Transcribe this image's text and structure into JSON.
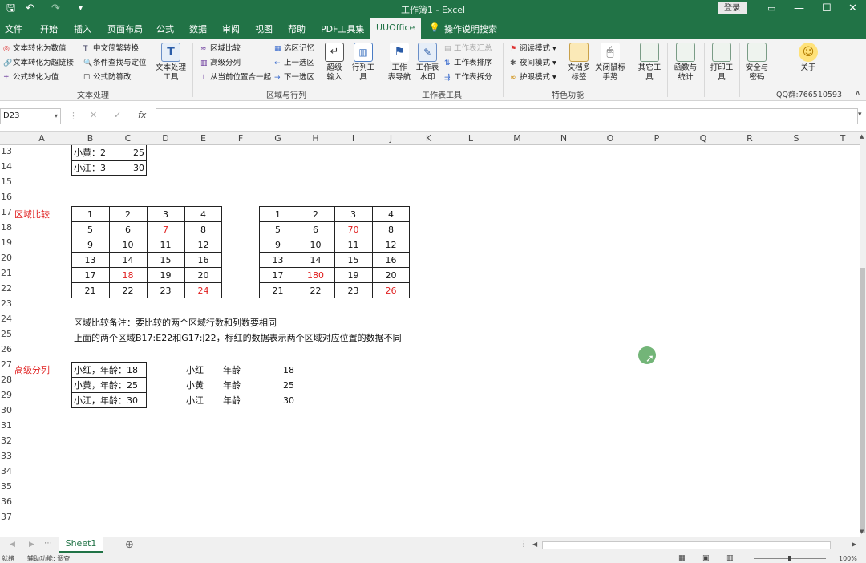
{
  "titlebar": {
    "title": "工作簿1 - Excel",
    "login_label": "登录",
    "save_icon": "save-icon",
    "undo_icon": "undo-icon",
    "redo_icon": "redo-icon"
  },
  "tabs": [
    "文件",
    "开始",
    "插入",
    "页面布局",
    "公式",
    "数据",
    "审阅",
    "视图",
    "帮助",
    "PDF工具集",
    "UUOffice",
    "操作说明搜索"
  ],
  "active_tab": "UUOffice",
  "ribbon": {
    "text_group": {
      "items": [
        "文本转化为数值",
        "中文简繁转换",
        "文本转化为超链接",
        "条件查找与定位",
        "公式转化为值",
        "公式防篡改"
      ],
      "big_button": "文本处理\n工具",
      "label": "文本处理"
    },
    "region_group": {
      "items": [
        "区域比较",
        "高级分列",
        "从当前位置合一起",
        "选区记忆",
        "上一选区",
        "下一选区"
      ],
      "big1": "超级\n输入",
      "big2": "行列工\n具",
      "label": "区域与行列"
    },
    "sheet_group": {
      "big1": "工作\n表导航",
      "big2": "工作表\n水印",
      "items": [
        "工作表汇总",
        "工作表排序",
        "工作表拆分"
      ],
      "label": "工作表工具"
    },
    "special_group": {
      "items": [
        "阅读模式",
        "夜间模式",
        "护眼模式"
      ],
      "big1": "文档多\n标签",
      "big2": "关闭鼠标\n手势",
      "label": "特色功能"
    },
    "misc_buttons": [
      "其它工\n具",
      "函数与\n统计",
      "打印工\n具",
      "安全与\n密码",
      "关于"
    ],
    "qq": "QQ群:766510593"
  },
  "formulabar": {
    "namebox": "D23",
    "fx": "fx",
    "value": ""
  },
  "columns": [
    "A",
    "B",
    "C",
    "D",
    "E",
    "F",
    "G",
    "H",
    "I",
    "J",
    "K",
    "L",
    "M",
    "N",
    "O",
    "P",
    "Q",
    "R",
    "S",
    "T"
  ],
  "rows": [
    "13",
    "14",
    "15",
    "16",
    "17",
    "18",
    "19",
    "20",
    "21",
    "22",
    "23",
    "24",
    "25",
    "26",
    "27",
    "28",
    "29",
    "30",
    "31",
    "32",
    "33",
    "34",
    "35",
    "36",
    "37"
  ],
  "sheet": {
    "r13b": "小黄：2",
    "r13c": "25",
    "r14b": "小江：3",
    "r14c": "30",
    "section1": "区域比较",
    "section2": "高级分列",
    "tableA": [
      [
        "1",
        "2",
        "3",
        "4"
      ],
      [
        "5",
        "6",
        "7",
        "8"
      ],
      [
        "9",
        "10",
        "11",
        "12"
      ],
      [
        "13",
        "14",
        "15",
        "16"
      ],
      [
        "17",
        "18",
        "19",
        "20"
      ],
      [
        "21",
        "22",
        "23",
        "24"
      ]
    ],
    "tableB": [
      [
        "1",
        "2",
        "3",
        "4"
      ],
      [
        "5",
        "6",
        "70",
        "8"
      ],
      [
        "9",
        "10",
        "11",
        "12"
      ],
      [
        "13",
        "14",
        "15",
        "16"
      ],
      [
        "17",
        "180",
        "19",
        "20"
      ],
      [
        "21",
        "22",
        "23",
        "26"
      ]
    ],
    "note1": "区域比较备注：要比较的两个区域行数和列数要相同",
    "note2": "上面的两个区域B17:E22和G17:J22，标红的数据表示两个区域对应位置的数据不同",
    "split_src": [
      "小红，年龄：18",
      "小黄，年龄：25",
      "小江，年龄：30"
    ],
    "split_name": [
      "小红",
      "小黄",
      "小江"
    ],
    "split_label": [
      "年龄",
      "年龄",
      "年龄"
    ],
    "split_age": [
      "18",
      "25",
      "30"
    ]
  },
  "sheet_tab": "Sheet1",
  "status": {
    "left": "就绪",
    "assist": "辅助功能: 调查",
    "zoom": "100%"
  },
  "colors": {
    "excel_green": "#217346",
    "red": "#e02020"
  }
}
